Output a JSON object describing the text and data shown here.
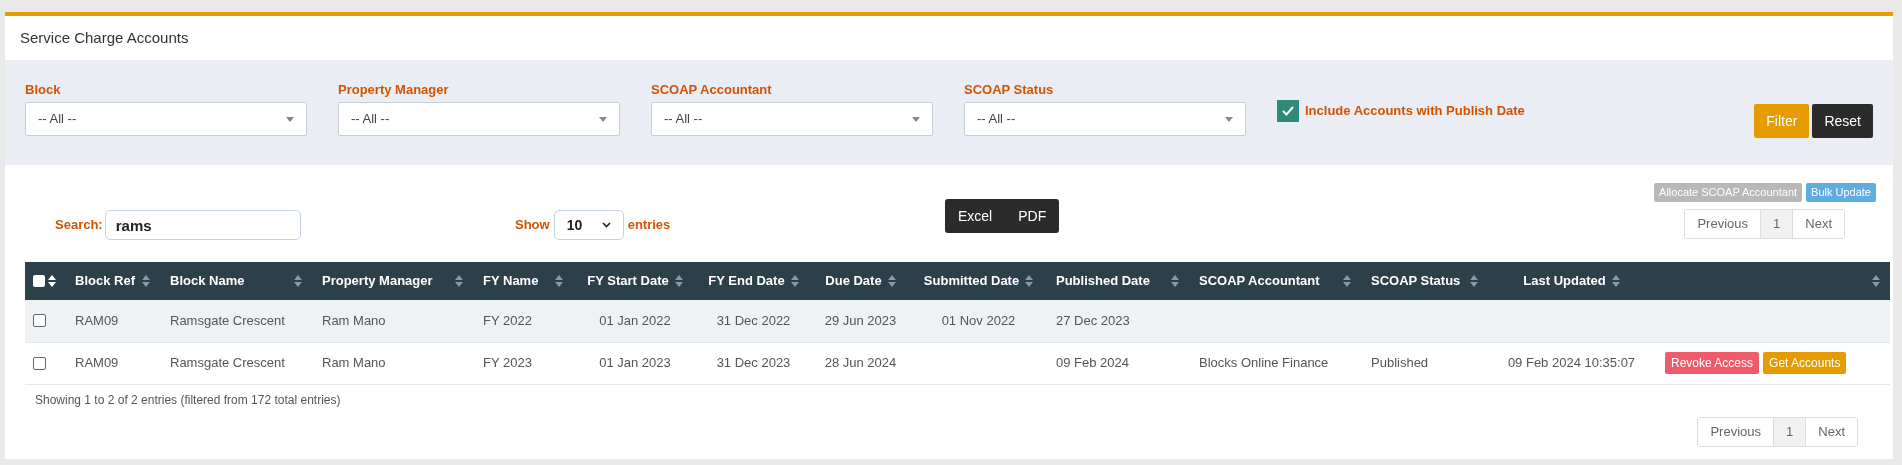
{
  "title": "Service Charge Accounts",
  "filters": [
    {
      "label": "Block",
      "value": "-- All --"
    },
    {
      "label": "Property Manager",
      "value": "-- All --"
    },
    {
      "label": "SCOAP Accountant",
      "value": "-- All --"
    },
    {
      "label": "SCOAP Status",
      "value": "-- All --"
    }
  ],
  "include_publish": {
    "label": "Include Accounts with Publish Date",
    "checked": true
  },
  "filter_buttons": [
    {
      "label": "Filter",
      "kind": "primary"
    },
    {
      "label": "Reset",
      "kind": "dark"
    }
  ],
  "top_actions": [
    {
      "label": "Allocate SCOAP Accountant",
      "disabled": true
    },
    {
      "label": "Bulk Update",
      "disabled": false
    }
  ],
  "search": {
    "label": "Search:",
    "value": "rams"
  },
  "length": {
    "before": "Show",
    "value": "10",
    "after": "entries"
  },
  "export_buttons": [
    "Excel",
    "PDF"
  ],
  "pagination_top": {
    "previous": "Previous",
    "pages": [
      {
        "label": "1",
        "selected": true
      }
    ],
    "next": "Next"
  },
  "table": {
    "select_all": {
      "checked": false
    },
    "columns": [
      {
        "label": "Block Ref"
      },
      {
        "label": "Block Name"
      },
      {
        "label": "Property Manager"
      },
      {
        "label": "FY Name"
      },
      {
        "label": "FY Start Date"
      },
      {
        "label": "FY End Date"
      },
      {
        "label": "Due Date"
      },
      {
        "label": "Submitted Date"
      },
      {
        "label": "Published Date"
      },
      {
        "label": "SCOAP Accountant"
      },
      {
        "label": "SCOAP Status"
      },
      {
        "label": "Last Updated"
      }
    ],
    "rows": [
      {
        "checked": false,
        "cells": [
          "RAM09",
          "Ramsgate Crescent",
          "Ram Mano",
          "FY 2022",
          "01 Jan 2022",
          "31 Dec 2022",
          "29 Jun 2023",
          "01 Nov 2022",
          "27 Dec 2023",
          "",
          "",
          ""
        ]
      },
      {
        "checked": false,
        "cells": [
          "RAM09",
          "Ramsgate Crescent",
          "Ram Mano",
          "FY 2023",
          "01 Jan 2023",
          "31 Dec 2023",
          "28 Jun 2024",
          "",
          "09 Feb 2024",
          "Blocks Online Finance",
          "Published",
          "09 Feb 2024 10:35:07"
        ],
        "actions": [
          {
            "label": "Revoke Access",
            "kind": "danger"
          },
          {
            "label": "Get Accounts",
            "kind": "warning"
          }
        ]
      }
    ]
  },
  "info": "Showing 1 to 2 of 2 entries (filtered from 172 total entries)",
  "pagination_bottom": {
    "previous": "Previous",
    "pages": [
      {
        "label": "1",
        "selected": true
      }
    ],
    "next": "Next"
  }
}
